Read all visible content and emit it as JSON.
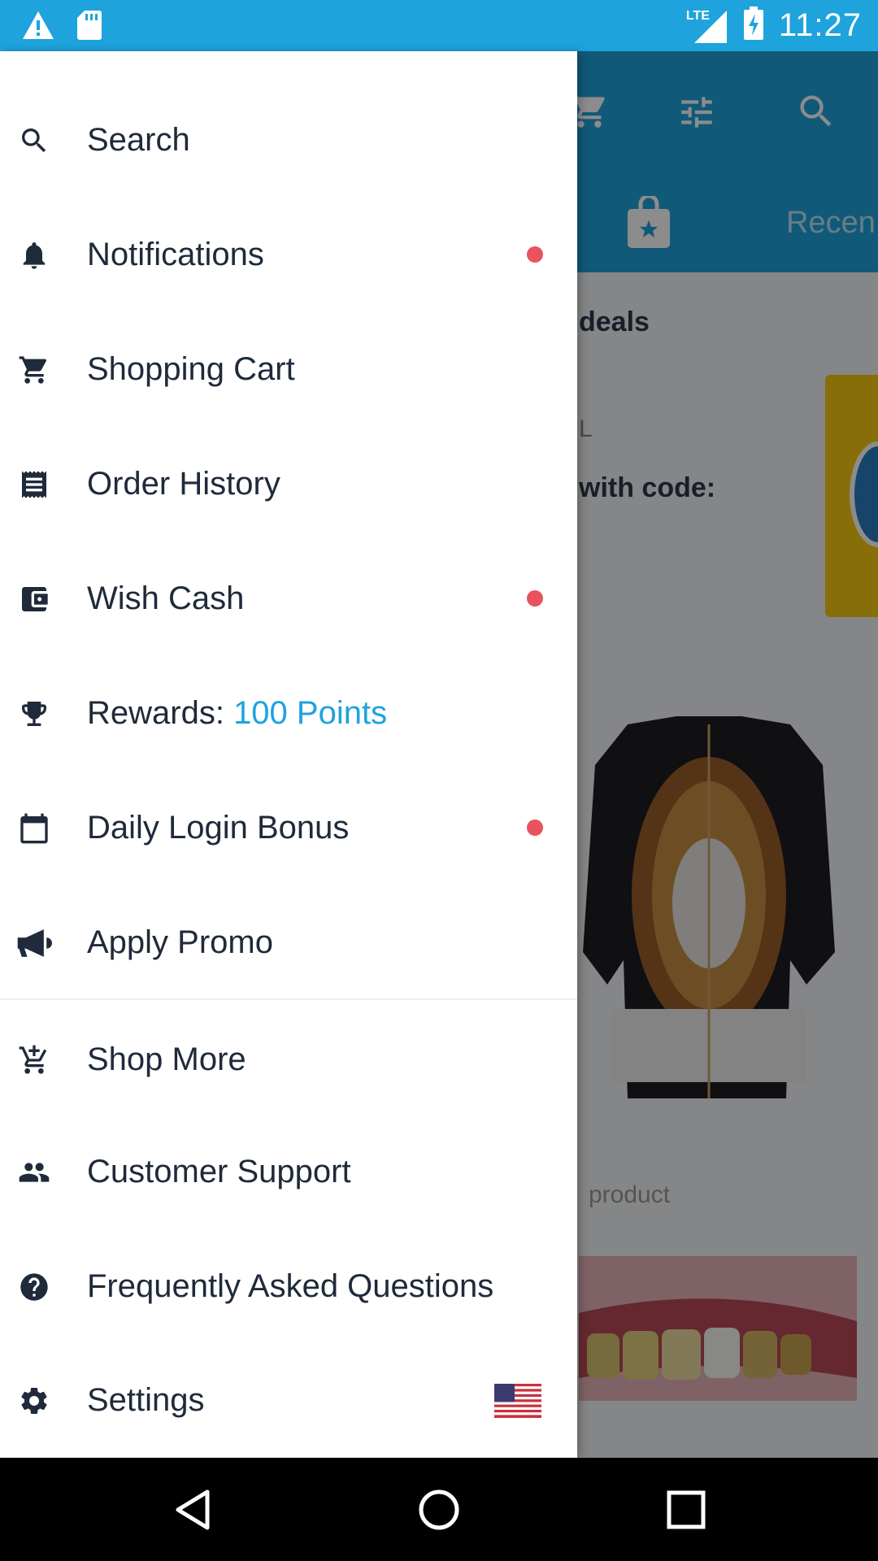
{
  "status_bar": {
    "time": "11:27",
    "network": "LTE",
    "icons": [
      "warning-icon",
      "sd-card-icon",
      "signal-icon",
      "battery-charging-icon"
    ]
  },
  "background": {
    "tab_label": "Recen",
    "deals_label": "deals",
    "fragment": "L",
    "code_label": "with code:",
    "product_label": "product"
  },
  "drawer": {
    "items": [
      {
        "label": "Search",
        "icon": "search-icon",
        "badge": false
      },
      {
        "label": "Notifications",
        "icon": "bell-icon",
        "badge": true
      },
      {
        "label": "Shopping Cart",
        "icon": "cart-icon",
        "badge": false
      },
      {
        "label": "Order History",
        "icon": "receipt-icon",
        "badge": false
      },
      {
        "label": "Wish Cash",
        "icon": "wallet-icon",
        "badge": true
      },
      {
        "label": "Rewards: ",
        "points": "100 Points",
        "icon": "trophy-icon",
        "badge": false
      },
      {
        "label": "Daily Login Bonus",
        "icon": "calendar-icon",
        "badge": true
      },
      {
        "label": "Apply Promo",
        "icon": "megaphone-icon",
        "badge": false
      },
      {
        "label": "Shop More",
        "icon": "add-cart-icon",
        "badge": false
      },
      {
        "label": "Customer Support",
        "icon": "people-icon",
        "badge": false
      },
      {
        "label": "Frequently Asked Questions",
        "icon": "help-icon",
        "badge": false
      },
      {
        "label": "Settings",
        "icon": "gear-icon",
        "badge": false,
        "flag": "us-flag-icon"
      }
    ]
  },
  "colors": {
    "accent": "#1ea3dc",
    "badge": "#e8535e",
    "text": "#1f2a3a"
  }
}
